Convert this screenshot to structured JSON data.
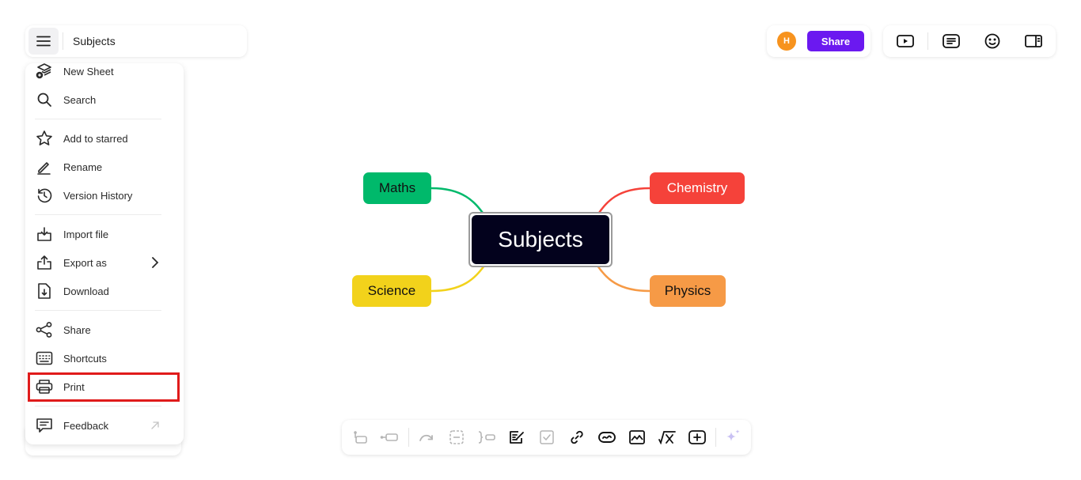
{
  "header": {
    "menu_icon": "hamburger-icon",
    "title": "Subjects"
  },
  "menu": {
    "items": [
      {
        "label": "New Sheet",
        "icon": "new-sheet-icon"
      },
      {
        "label": "Search",
        "icon": "search-icon"
      },
      {
        "label": "Add to starred",
        "icon": "star-icon"
      },
      {
        "label": "Rename",
        "icon": "pencil-icon"
      },
      {
        "label": "Version History",
        "icon": "history-icon"
      },
      {
        "label": "Import file",
        "icon": "import-icon"
      },
      {
        "label": "Export as",
        "icon": "export-icon",
        "trailing": "chevron-right-icon"
      },
      {
        "label": "Download",
        "icon": "download-file-icon"
      },
      {
        "label": "Share",
        "icon": "share-icon"
      },
      {
        "label": "Shortcuts",
        "icon": "keyboard-icon"
      },
      {
        "label": "Print",
        "icon": "printer-icon",
        "highlighted": true
      },
      {
        "label": "Feedback",
        "icon": "feedback-icon",
        "trailing": "external-arrow-icon"
      }
    ]
  },
  "topbar": {
    "avatar_initial": "H",
    "avatar_color": "#f7931e",
    "share_label": "Share",
    "share_color": "#6b19f0",
    "tools": [
      "present-icon",
      "notes-icon",
      "emoji-icon",
      "sidebar-panel-icon"
    ]
  },
  "mindmap": {
    "root": {
      "label": "Subjects",
      "color": "#03021d"
    },
    "children": [
      {
        "label": "Maths",
        "color": "#00b96b",
        "text_color": "#111111",
        "side": "left-top"
      },
      {
        "label": "Science",
        "color": "#f2d21b",
        "text_color": "#111111",
        "side": "left-bottom"
      },
      {
        "label": "Chemistry",
        "color": "#f5423a",
        "text_color": "#ffffff",
        "side": "right-top"
      },
      {
        "label": "Physics",
        "color": "#f69a46",
        "text_color": "#111111",
        "side": "right-bottom"
      }
    ]
  },
  "bottom_toolbar": {
    "tools": [
      {
        "name": "add-parent-icon",
        "enabled": false
      },
      {
        "name": "add-child-icon",
        "enabled": false
      },
      {
        "name": "relationship-icon",
        "enabled": false
      },
      {
        "name": "boundary-icon",
        "enabled": false
      },
      {
        "name": "summary-icon",
        "enabled": false
      },
      {
        "name": "note-icon",
        "enabled": true
      },
      {
        "name": "task-checkbox-icon",
        "enabled": false
      },
      {
        "name": "link-icon",
        "enabled": true
      },
      {
        "name": "hyperlink-icon",
        "enabled": true
      },
      {
        "name": "image-icon",
        "enabled": true
      },
      {
        "name": "formula-icon",
        "enabled": true
      },
      {
        "name": "insert-topic-icon",
        "enabled": true
      },
      {
        "name": "ai-sparkle-icon",
        "enabled": true
      }
    ]
  }
}
